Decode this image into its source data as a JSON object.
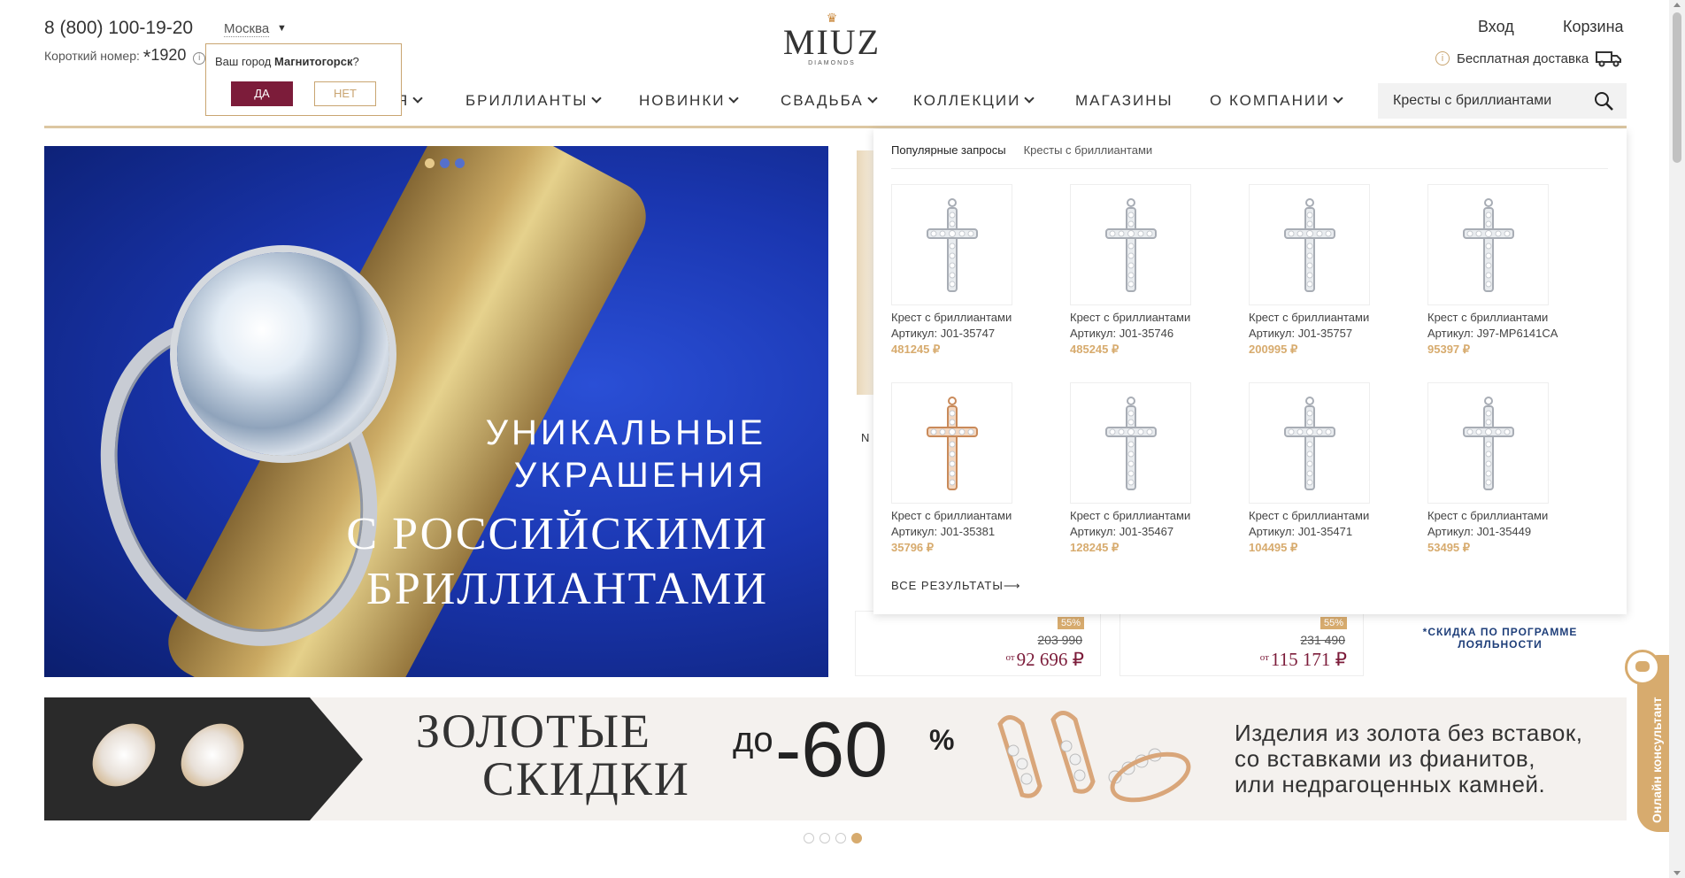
{
  "header": {
    "phone": "8 (800) 100-19-20",
    "short_label": "Короткий номер:",
    "short_star": "*",
    "short_number": "1920",
    "info_mark": "i",
    "city": "Москва",
    "login": "Вход",
    "cart": "Корзина",
    "delivery": "Бесплатная доставка"
  },
  "city_popup": {
    "question_prefix": "Ваш город ",
    "city": "Магнитогорск",
    "question_suffix": "?",
    "yes": "ДА",
    "no": "НЕТ"
  },
  "logo": {
    "word": "MIUZ",
    "sub": "DIAMONDS"
  },
  "nav": {
    "partial": "Я",
    "items": [
      "БРИЛЛИАНТЫ",
      "НОВИНКИ",
      "СВАДЬБА",
      "КОЛЛЕКЦИИ",
      "МАГАЗИНЫ",
      "О КОМПАНИИ"
    ]
  },
  "search": {
    "value": "Кресты с бриллиантами"
  },
  "hero": {
    "line1": "УНИКАЛЬНЫЕ",
    "line2": "УКРАШЕНИЯ",
    "line3": "С РОССИЙСКИМИ",
    "line4": "БРИЛЛИАНТАМИ"
  },
  "dropdown": {
    "tab_popular": "Популярные запросы",
    "tab_query": "Кресты с бриллиантами",
    "all_results": "ВСЕ РЕЗУЛЬТАТЫ⟶",
    "products": [
      {
        "name": "Крест с бриллиантами",
        "article": "Артикул: J01-35747",
        "price": "481245 ₽",
        "metal": "white"
      },
      {
        "name": "Крест с бриллиантами",
        "article": "Артикул: J01-35746",
        "price": "485245 ₽",
        "metal": "white"
      },
      {
        "name": "Крест с бриллиантами",
        "article": "Артикул: J01-35757",
        "price": "200995 ₽",
        "metal": "white"
      },
      {
        "name": "Крест с бриллиантами",
        "article": "Артикул: J97-MP6141CA",
        "price": "95397 ₽",
        "metal": "white"
      },
      {
        "name": "Крест с бриллиантами",
        "article": "Артикул: J01-35381",
        "price": "35796 ₽",
        "metal": "rose"
      },
      {
        "name": "Крест с бриллиантами",
        "article": "Артикул: J01-35467",
        "price": "128245 ₽",
        "metal": "white"
      },
      {
        "name": "Крест с бриллиантами",
        "article": "Артикул: J01-35471",
        "price": "104495 ₽",
        "metal": "white"
      },
      {
        "name": "Крест с бриллиантами",
        "article": "Артикул: J01-35449",
        "price": "53495 ₽",
        "metal": "white"
      }
    ]
  },
  "background_cards": {
    "partial_label": "N",
    "card1": {
      "badge": "55%",
      "old_price": "203 990",
      "from": "от",
      "price": "92 696 ₽"
    },
    "card2": {
      "badge": "55%",
      "old_price": "231 490",
      "from": "от",
      "price": "115 171 ₽"
    },
    "loyalty": "*СКИДКА ПО ПРОГРАММЕ ЛОЯЛЬНОСТИ"
  },
  "banner": {
    "title_line1": "ЗОЛОТЫЕ",
    "title_line2": "СКИДКИ",
    "upto": "до",
    "percent": "-60",
    "percent_sign": "%",
    "desc_line1": "Изделия из золота без вставок,",
    "desc_line2": "со вставками из фианитов,",
    "desc_line3": "или недрагоценных камней."
  },
  "consultant": {
    "label": "Онлайн консультант"
  },
  "colors": {
    "gold": "#d7ab6e",
    "burgundy": "#7c1c3a",
    "hero_blue": "#1a36b0"
  }
}
